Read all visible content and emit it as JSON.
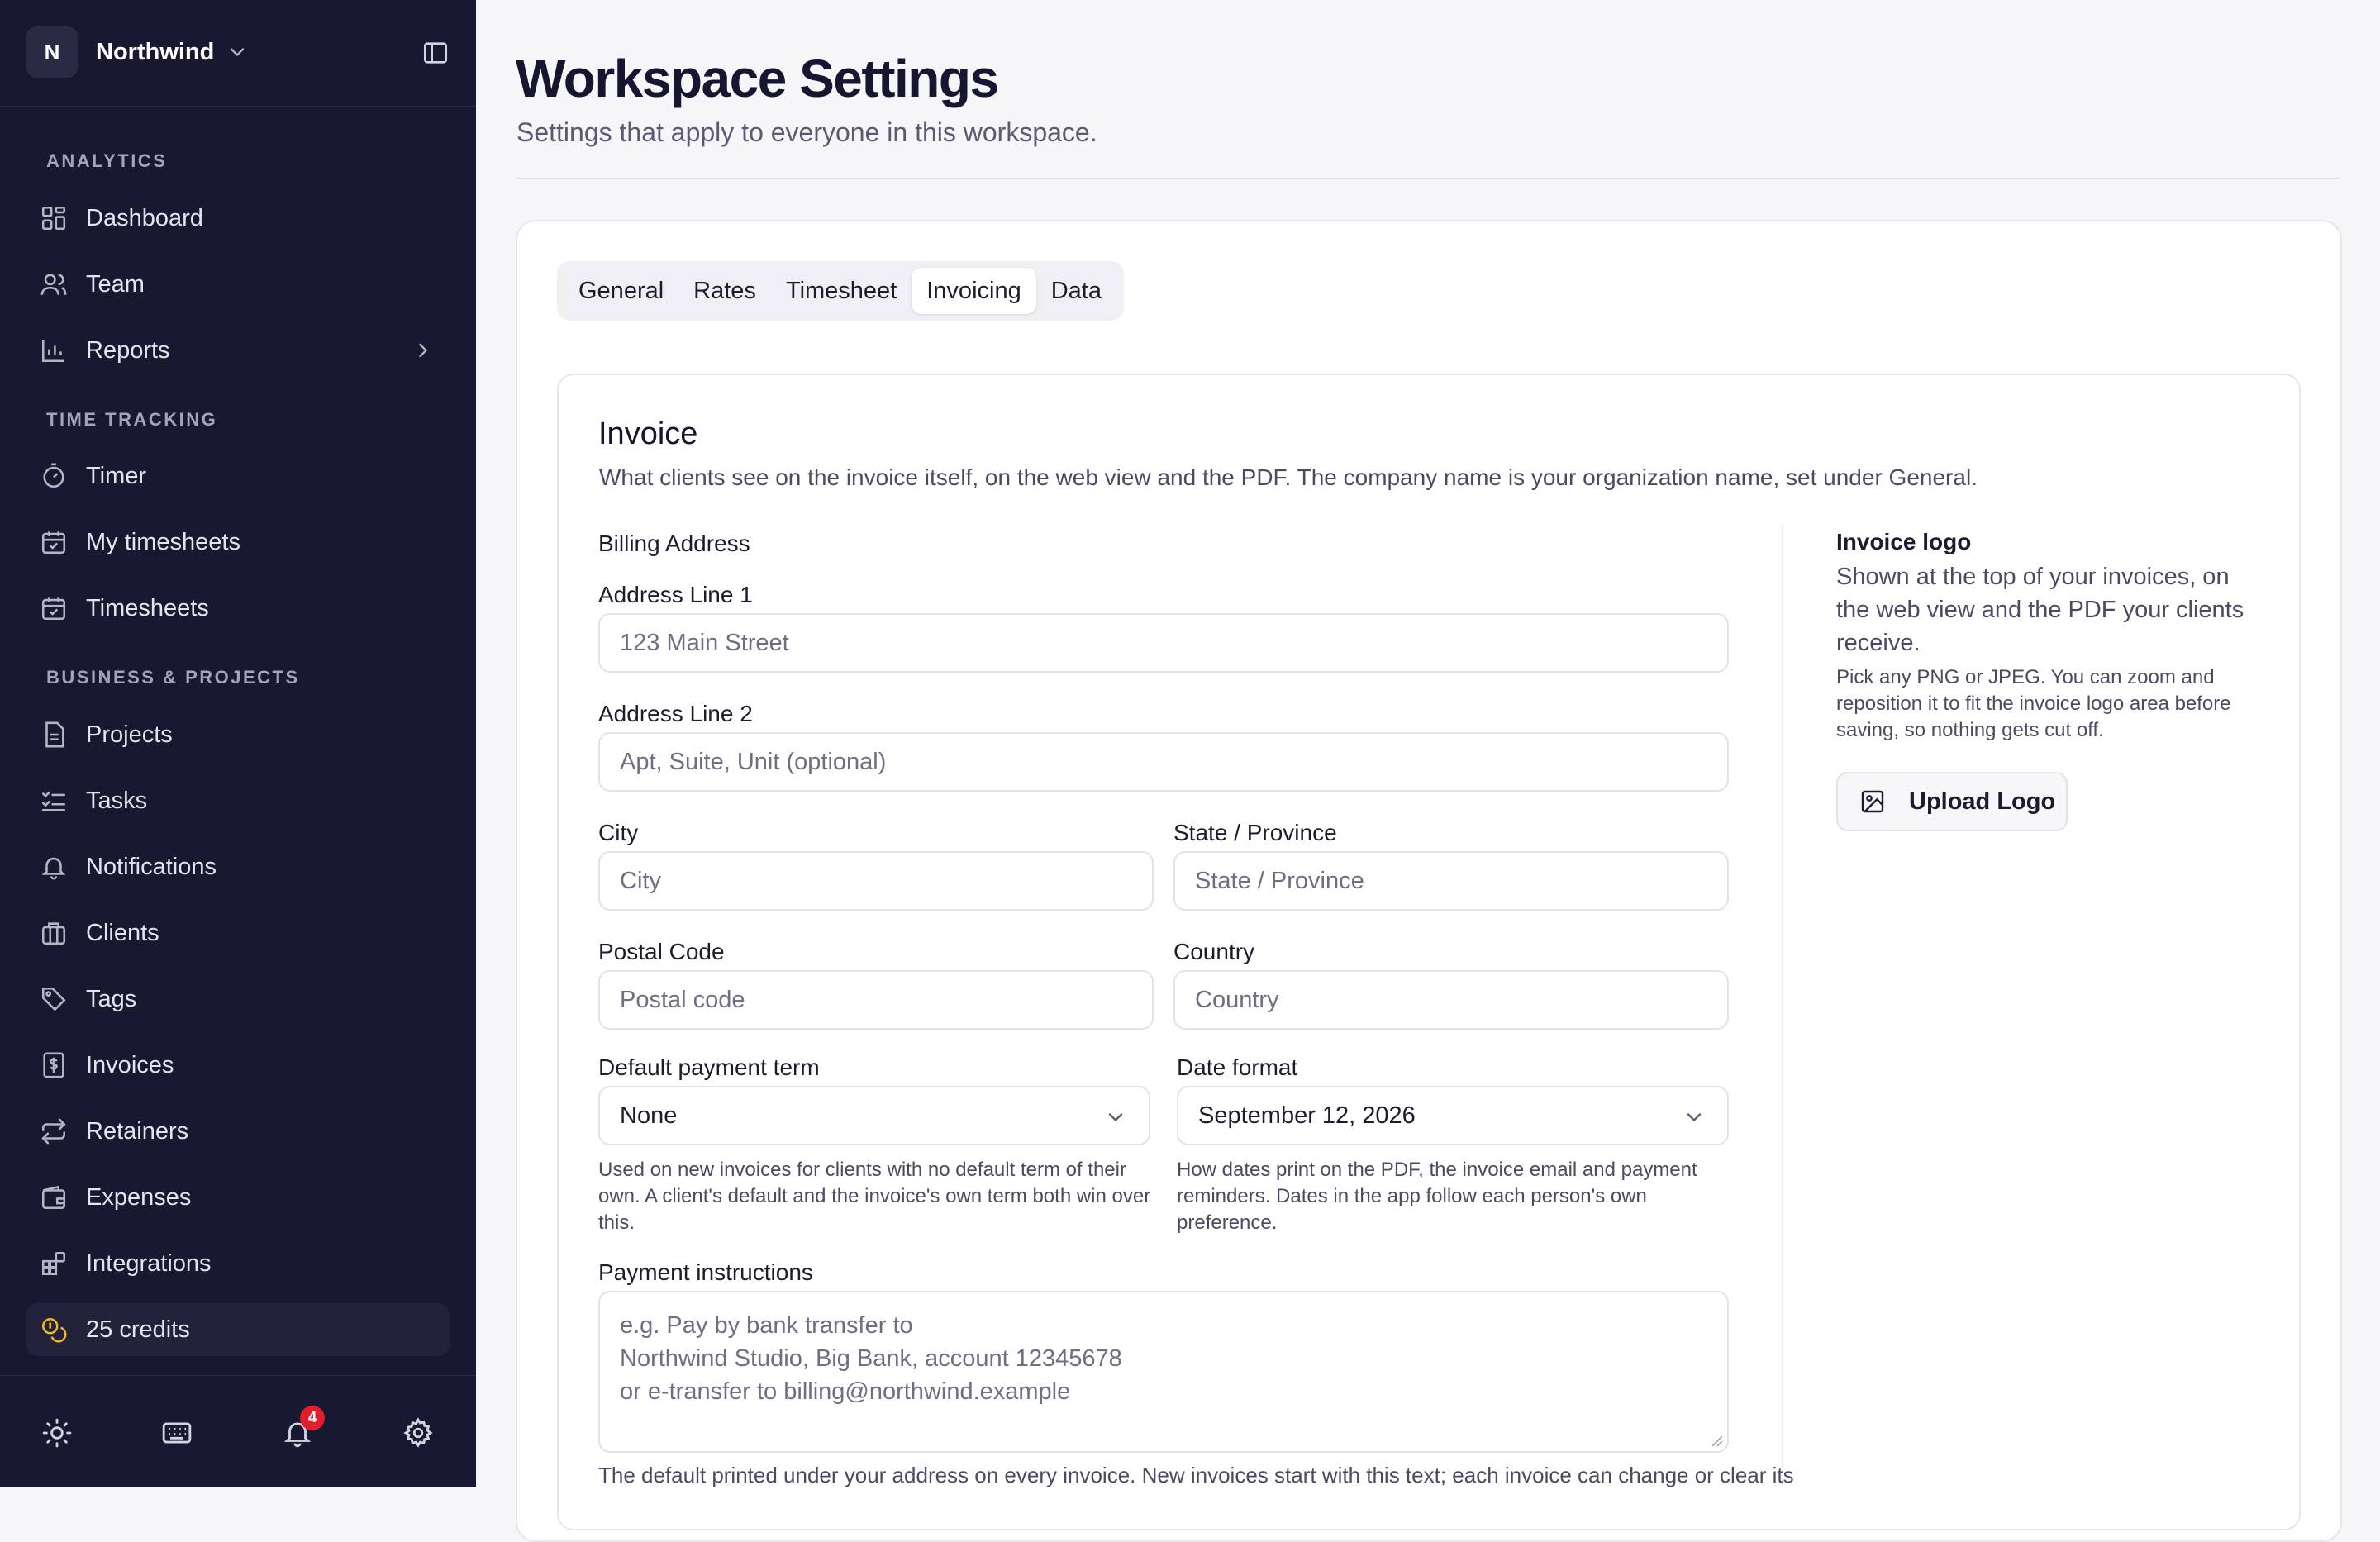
{
  "workspace": {
    "initial": "N",
    "name": "Northwind"
  },
  "sidebar": {
    "sections": {
      "analytics": "ANALYTICS",
      "time_tracking": "TIME TRACKING",
      "business": "BUSINESS & PROJECTS"
    },
    "items": {
      "dashboard": "Dashboard",
      "team": "Team",
      "reports": "Reports",
      "timer": "Timer",
      "my_timesheets": "My timesheets",
      "timesheets": "Timesheets",
      "projects": "Projects",
      "tasks": "Tasks",
      "notifications": "Notifications",
      "clients": "Clients",
      "tags": "Tags",
      "invoices": "Invoices",
      "retainers": "Retainers",
      "expenses": "Expenses",
      "integrations": "Integrations"
    },
    "credits": "25 credits",
    "notification_count": "4"
  },
  "header": {
    "title": "Workspace Settings",
    "subtitle": "Settings that apply to everyone in this workspace."
  },
  "tabs": [
    "General",
    "Rates",
    "Timesheet",
    "Invoicing",
    "Data"
  ],
  "active_tab": "Invoicing",
  "invoice": {
    "title": "Invoice",
    "description": "What clients see on the invoice itself, on the web view and the PDF. The company name is your organization name, set under General.",
    "billing_address_label": "Billing Address",
    "address1": {
      "label": "Address Line 1",
      "placeholder": "123 Main Street"
    },
    "address2": {
      "label": "Address Line 2",
      "placeholder": "Apt, Suite, Unit (optional)"
    },
    "city": {
      "label": "City",
      "placeholder": "City"
    },
    "state": {
      "label": "State / Province",
      "placeholder": "State / Province"
    },
    "postal": {
      "label": "Postal Code",
      "placeholder": "Postal code"
    },
    "country": {
      "label": "Country",
      "placeholder": "Country"
    },
    "payment_term": {
      "label": "Default payment term",
      "value": "None",
      "help": "Used on new invoices for clients with no default term of their own. A client's default and the invoice's own term both win over this."
    },
    "date_format": {
      "label": "Date format",
      "value": "September 12, 2026",
      "help": "How dates print on the PDF, the invoice email and payment reminders. Dates in the app follow each person's own preference."
    },
    "payment_instructions": {
      "label": "Payment instructions",
      "placeholder_lines": [
        "e.g. Pay by bank transfer to",
        "Northwind Studio, Big Bank, account 12345678",
        "or e-transfer to billing@northwind.example"
      ],
      "help": "The default printed under your address on every invoice. New invoices start with this text; each invoice can change or clear its"
    },
    "logo": {
      "title": "Invoice logo",
      "description": "Shown at the top of your invoices, on the web view and the PDF your clients receive.",
      "hint": "Pick any PNG or JPEG. You can zoom and reposition it to fit the invoice logo area before saving, so nothing gets cut off.",
      "button": "Upload Logo"
    }
  }
}
